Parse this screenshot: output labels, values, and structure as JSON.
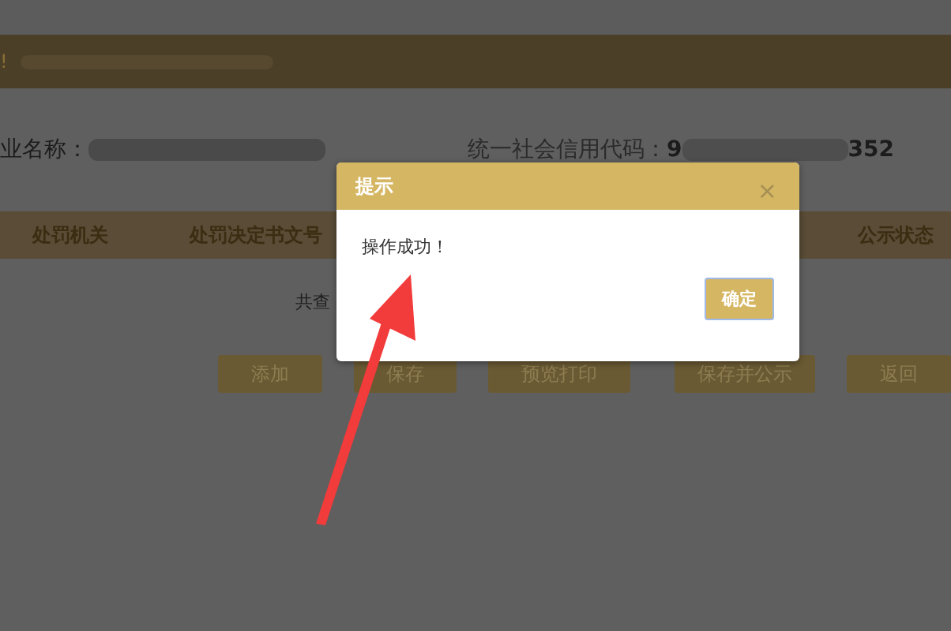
{
  "notice": {
    "icon_text": "!"
  },
  "company": {
    "name_label": "业名称：",
    "code_label": "统一社会信用代码：",
    "code_start": "9",
    "code_end": "352"
  },
  "table": {
    "columns": [
      {
        "label": "处罚机关"
      },
      {
        "label": "处罚决定书文号"
      },
      {
        "label": "公示状态"
      }
    ],
    "count_text": "共查"
  },
  "buttons": [
    {
      "label": "添加"
    },
    {
      "label": "保存"
    },
    {
      "label": "预览打印"
    },
    {
      "label": "保存并公示"
    },
    {
      "label": "返回"
    }
  ],
  "dialog": {
    "title": "提示",
    "close": "×",
    "message": "操作成功！",
    "confirm": "确定"
  }
}
